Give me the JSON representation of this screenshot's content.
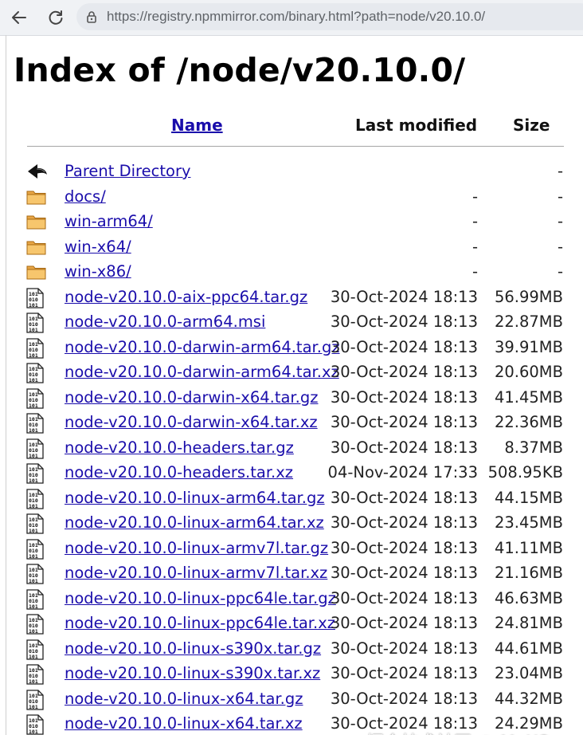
{
  "browser": {
    "url": "https://registry.npmmirror.com/binary.html?path=node/v20.10.0/"
  },
  "page": {
    "title": "Index of /node/v20.10.0/",
    "headers": {
      "name": "Name",
      "modified": "Last modified",
      "size": "Size"
    },
    "rows": [
      {
        "icon": "back-icon",
        "name": "Parent Directory",
        "modified": "",
        "size": "-"
      },
      {
        "icon": "folder-icon",
        "name": "docs/",
        "modified": "-",
        "size": "-"
      },
      {
        "icon": "folder-icon",
        "name": "win-arm64/",
        "modified": "-",
        "size": "-"
      },
      {
        "icon": "folder-icon",
        "name": "win-x64/",
        "modified": "-",
        "size": "-"
      },
      {
        "icon": "folder-icon",
        "name": "win-x86/",
        "modified": "-",
        "size": "-"
      },
      {
        "icon": "binary-file-icon",
        "name": "node-v20.10.0-aix-ppc64.tar.gz",
        "modified": "30-Oct-2024 18:13",
        "size": "56.99MB"
      },
      {
        "icon": "binary-file-icon",
        "name": "node-v20.10.0-arm64.msi",
        "modified": "30-Oct-2024 18:13",
        "size": "22.87MB"
      },
      {
        "icon": "binary-file-icon",
        "name": "node-v20.10.0-darwin-arm64.tar.gz",
        "modified": "30-Oct-2024 18:13",
        "size": "39.91MB"
      },
      {
        "icon": "binary-file-icon",
        "name": "node-v20.10.0-darwin-arm64.tar.xz",
        "modified": "30-Oct-2024 18:13",
        "size": "20.60MB"
      },
      {
        "icon": "binary-file-icon",
        "name": "node-v20.10.0-darwin-x64.tar.gz",
        "modified": "30-Oct-2024 18:13",
        "size": "41.45MB"
      },
      {
        "icon": "binary-file-icon",
        "name": "node-v20.10.0-darwin-x64.tar.xz",
        "modified": "30-Oct-2024 18:13",
        "size": "22.36MB"
      },
      {
        "icon": "binary-file-icon",
        "name": "node-v20.10.0-headers.tar.gz",
        "modified": "30-Oct-2024 18:13",
        "size": "8.37MB"
      },
      {
        "icon": "binary-file-icon",
        "name": "node-v20.10.0-headers.tar.xz",
        "modified": "04-Nov-2024 17:33",
        "size": "508.95KB"
      },
      {
        "icon": "binary-file-icon",
        "name": "node-v20.10.0-linux-arm64.tar.gz",
        "modified": "30-Oct-2024 18:13",
        "size": "44.15MB"
      },
      {
        "icon": "binary-file-icon",
        "name": "node-v20.10.0-linux-arm64.tar.xz",
        "modified": "30-Oct-2024 18:13",
        "size": "23.45MB"
      },
      {
        "icon": "binary-file-icon",
        "name": "node-v20.10.0-linux-armv7l.tar.gz",
        "modified": "30-Oct-2024 18:13",
        "size": "41.11MB"
      },
      {
        "icon": "binary-file-icon",
        "name": "node-v20.10.0-linux-armv7l.tar.xz",
        "modified": "30-Oct-2024 18:13",
        "size": "21.16MB"
      },
      {
        "icon": "binary-file-icon",
        "name": "node-v20.10.0-linux-ppc64le.tar.gz",
        "modified": "30-Oct-2024 18:13",
        "size": "46.63MB"
      },
      {
        "icon": "binary-file-icon",
        "name": "node-v20.10.0-linux-ppc64le.tar.xz",
        "modified": "30-Oct-2024 18:13",
        "size": "24.81MB"
      },
      {
        "icon": "binary-file-icon",
        "name": "node-v20.10.0-linux-s390x.tar.gz",
        "modified": "30-Oct-2024 18:13",
        "size": "44.61MB"
      },
      {
        "icon": "binary-file-icon",
        "name": "node-v20.10.0-linux-s390x.tar.xz",
        "modified": "30-Oct-2024 18:13",
        "size": "23.04MB"
      },
      {
        "icon": "binary-file-icon",
        "name": "node-v20.10.0-linux-x64.tar.gz",
        "modified": "30-Oct-2024 18:13",
        "size": "44.32MB"
      },
      {
        "icon": "binary-file-icon",
        "name": "node-v20.10.0-linux-x64.tar.xz",
        "modified": "30-Oct-2024 18:13",
        "size": "24.29MB"
      }
    ]
  },
  "watermark": "掘金技术社区 @ MoXC"
}
